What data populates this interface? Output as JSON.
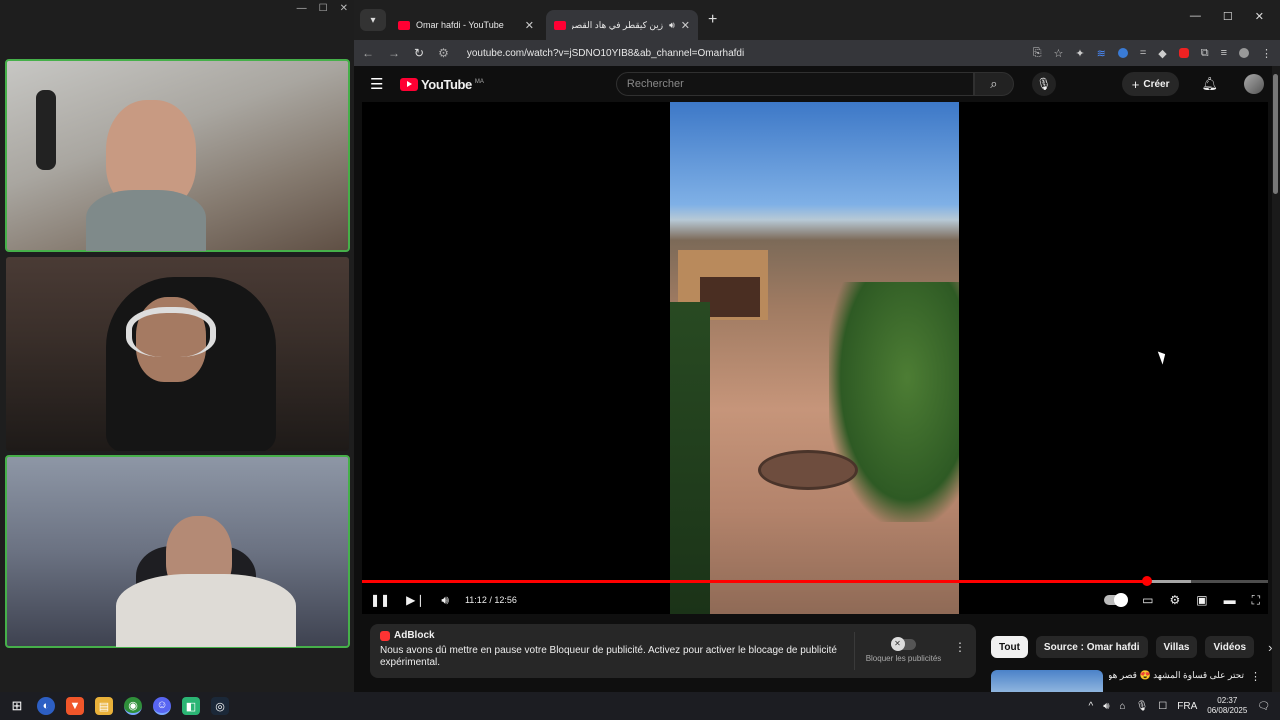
{
  "call": {
    "window_controls": [
      "—",
      "☐",
      "✕"
    ]
  },
  "browser": {
    "tabs": [
      {
        "title": "Omar hafdi - YouTube",
        "active": false
      },
      {
        "title": "زين كيقطر في هاد القصر الـ",
        "active": true
      }
    ],
    "tab_close": "✕",
    "new_tab": "+",
    "url": "youtube.com/watch?v=jSDNO10YIB8&ab_channel=Omarhafdi",
    "window_controls": [
      "—",
      "☐",
      "✕"
    ]
  },
  "youtube": {
    "logo_text": "YouTube",
    "region": "MA",
    "search_placeholder": "Rechercher",
    "create_label": "Créer",
    "player": {
      "current_time": "11:12",
      "duration": "12:56",
      "time_display": "11:12 / 12:56",
      "progress": 0.866,
      "buffered": 0.915
    },
    "adblock": {
      "brand": "AdBlock",
      "message": "Nous avons dû mettre en pause votre Bloqueur de publicité. Activez pour activer le blocage de publicité expérimental.",
      "toggle_label": "Bloquer les publicités"
    },
    "chips": [
      "Tout",
      "Source : Omar hafdi",
      "Villas",
      "Vidéos"
    ],
    "recommendation_title": "تحتر على قساوة المشهد 😍 قصر هوتة للبيع"
  },
  "taskbar": {
    "language": "FRA",
    "time": "02:37",
    "date": "06/08/2025"
  },
  "colors": {
    "youtube_red": "#ff0033",
    "active_tile_border": "#46b04a",
    "progress": "#ff0000"
  }
}
